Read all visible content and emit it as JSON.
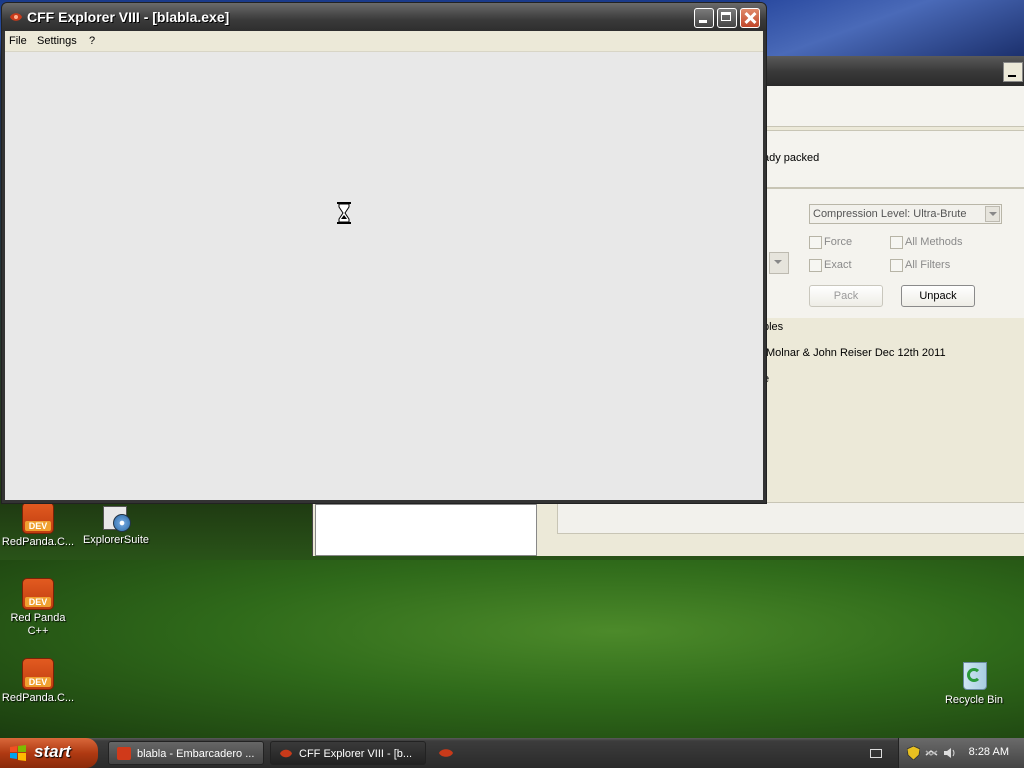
{
  "desktop": {
    "icons": [
      {
        "label": "RedPanda.C...",
        "badge": "DEV"
      },
      {
        "label": "ExplorerSuite"
      },
      {
        "label": "Red Panda C++",
        "badge": "DEV"
      },
      {
        "label": "RedPanda.C...",
        "badge": "DEV"
      },
      {
        "label": "Recycle Bin"
      }
    ]
  },
  "background_window": {
    "status_text": "ady packed",
    "compression_select": "Compression Level: Ultra-Brute",
    "options": [
      {
        "label": "Force",
        "checked": false
      },
      {
        "label": "All Methods",
        "checked": false
      },
      {
        "label": "Exact",
        "checked": false
      },
      {
        "label": "All Filters",
        "checked": false
      }
    ],
    "pack_label": "Pack",
    "unpack_label": "Unpack",
    "info_line1": "bles",
    "info_line2": "Molnar & John Reiser   Dec 12th 2011",
    "info_line3": "e"
  },
  "main_window": {
    "title": "CFF Explorer VIII - [blabla.exe]",
    "menu": [
      "File",
      "Settings",
      "?"
    ]
  },
  "taskbar": {
    "start_label": "start",
    "tasks": [
      {
        "label": "blabla - Embarcadero ...",
        "active": false
      },
      {
        "label": "CFF Explorer VIII - [b...",
        "active": true
      }
    ],
    "clock": "8:28 AM"
  },
  "colors": {
    "accent": "#c0462a",
    "window_bg": "#ece9d8",
    "client_bg": "#e8e8e8"
  }
}
